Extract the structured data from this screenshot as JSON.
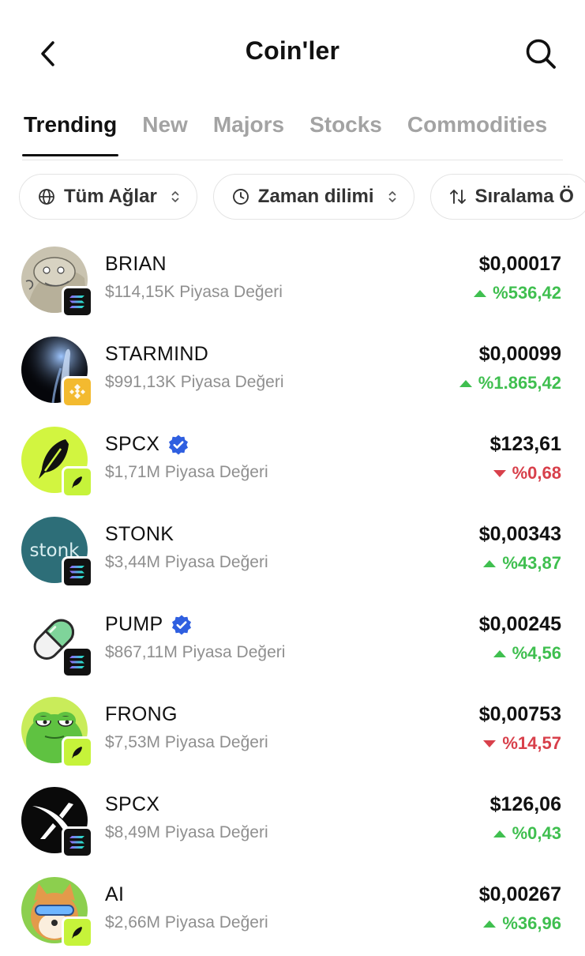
{
  "header": {
    "title": "Coin'ler",
    "back_icon": "chevron-left-icon",
    "search_icon": "search-icon"
  },
  "tabs": [
    {
      "label": "Trending",
      "active": true
    },
    {
      "label": "New",
      "active": false
    },
    {
      "label": "Majors",
      "active": false
    },
    {
      "label": "Stocks",
      "active": false
    },
    {
      "label": "Commodities",
      "active": false
    }
  ],
  "filters": [
    {
      "label": "Tüm Ağlar",
      "icon": "globe-icon"
    },
    {
      "label": "Zaman dilimi",
      "icon": "clock-icon"
    },
    {
      "label": "Sıralama Ö",
      "icon": "sort-icon"
    }
  ],
  "colors": {
    "up": "#3fbf4f",
    "down": "#d8404b",
    "verified": "#2f5fe0",
    "solana_badge": "#111111",
    "bnb_badge": "#f3ba2f",
    "pump_badge": "#c6f33a"
  },
  "coins": [
    {
      "name": "BRIAN",
      "mcap": "$114,15K Piyasa Değeri",
      "price": "$0,00017",
      "change": "%536,42",
      "direction": "up",
      "verified": false,
      "chain": "solana"
    },
    {
      "name": "STARMIND",
      "mcap": "$991,13K Piyasa Değeri",
      "price": "$0,00099",
      "change": "%1.865,42",
      "direction": "up",
      "verified": false,
      "chain": "bnb"
    },
    {
      "name": "SPCX",
      "mcap": "$1,71M Piyasa Değeri",
      "price": "$123,61",
      "change": "%0,68",
      "direction": "down",
      "verified": true,
      "chain": "pump"
    },
    {
      "name": "STONK",
      "mcap": "$3,44M Piyasa Değeri",
      "price": "$0,00343",
      "change": "%43,87",
      "direction": "up",
      "verified": false,
      "chain": "solana",
      "logo_text": "stonk"
    },
    {
      "name": "PUMP",
      "mcap": "$867,11M Piyasa Değeri",
      "price": "$0,00245",
      "change": "%4,56",
      "direction": "up",
      "verified": true,
      "chain": "solana"
    },
    {
      "name": "FRONG",
      "mcap": "$7,53M Piyasa Değeri",
      "price": "$0,00753",
      "change": "%14,57",
      "direction": "down",
      "verified": false,
      "chain": "pump"
    },
    {
      "name": "SPCX",
      "mcap": "$8,49M Piyasa Değeri",
      "price": "$126,06",
      "change": "%0,43",
      "direction": "up",
      "verified": false,
      "chain": "solana"
    },
    {
      "name": "AI",
      "mcap": "$2,66M Piyasa Değeri",
      "price": "$0,00267",
      "change": "%36,96",
      "direction": "up",
      "verified": false,
      "chain": "pump"
    }
  ]
}
